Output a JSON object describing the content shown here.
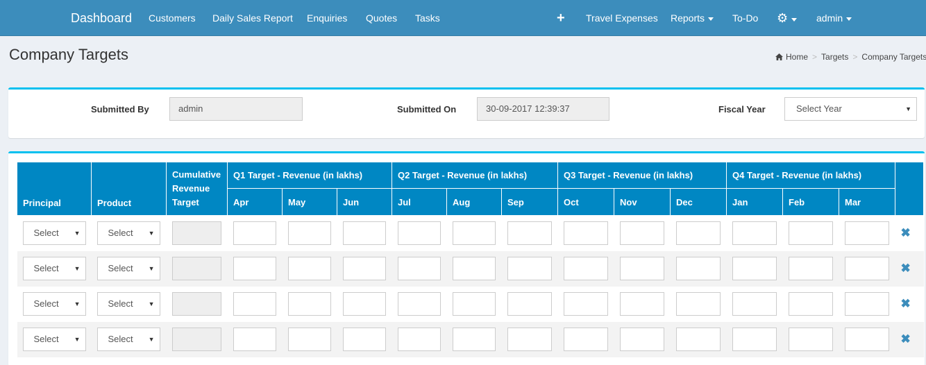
{
  "nav": {
    "brand": "Dashboard",
    "items": [
      "Customers",
      "Daily Sales Report",
      "Enquiries",
      "Quotes",
      "Tasks"
    ],
    "right": {
      "plus_icon": "plus-icon",
      "travel": "Travel Expenses",
      "reports": "Reports",
      "todo": "To-Do",
      "settings_icon": "gear-icon",
      "user": "admin"
    }
  },
  "page": {
    "title": "Company Targets",
    "breadcrumb": [
      "Home",
      "Targets",
      "Company Targets"
    ]
  },
  "form": {
    "submitted_by_label": "Submitted By",
    "submitted_by_value": "admin",
    "submitted_on_label": "Submitted On",
    "submitted_on_value": "30-09-2017 12:39:37",
    "fiscal_year_label": "Fiscal Year",
    "fiscal_year_value": "Select Year"
  },
  "table": {
    "principal": "Principal",
    "product": "Product",
    "cumulative": "Cumulative Revenue Target",
    "quarters": [
      "Q1 Target - Revenue (in lakhs)",
      "Q2 Target - Revenue (in lakhs)",
      "Q3 Target - Revenue (in lakhs)",
      "Q4 Target - Revenue (in lakhs)"
    ],
    "months": [
      "Apr",
      "May",
      "Jun",
      "Jul",
      "Aug",
      "Sep",
      "Oct",
      "Nov",
      "Dec",
      "Jan",
      "Feb",
      "Mar"
    ],
    "rows": [
      {
        "principal": "Select",
        "product": "Select"
      },
      {
        "principal": "Select",
        "product": "Select"
      },
      {
        "principal": "Select",
        "product": "Select"
      },
      {
        "principal": "Select",
        "product": "Select"
      }
    ]
  },
  "colors": {
    "navbar": "#3c8dbc",
    "table_header": "#0087c3",
    "box_accent": "#00c0ef",
    "delete_icon": "#3c8dbc"
  }
}
